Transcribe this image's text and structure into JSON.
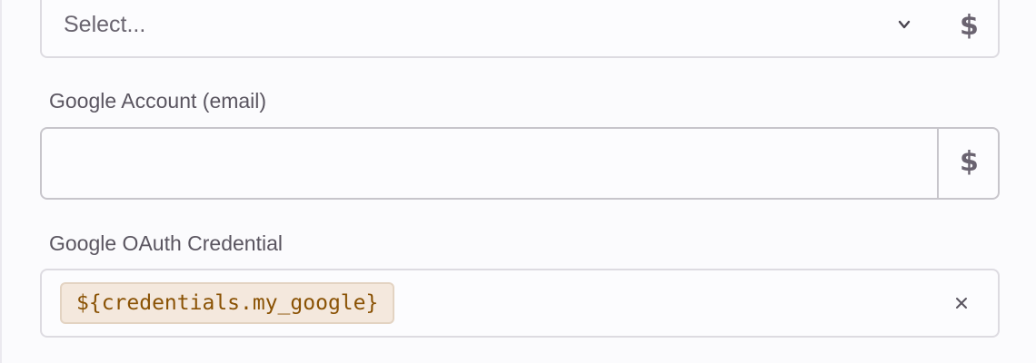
{
  "select_field": {
    "placeholder": "Select...",
    "chevron_icon": "chevron-down-icon",
    "variable_toggle": "$"
  },
  "email_field": {
    "label": "Google Account (email)",
    "value": "",
    "variable_toggle": "$"
  },
  "oauth_field": {
    "label": "Google OAuth Credential",
    "chip_value": "${credentials.my_google}",
    "clear_icon": "close-icon"
  },
  "colors": {
    "chip_bg": "#f4e8dd",
    "chip_text": "#8a5204",
    "border": "#dddbe1"
  }
}
